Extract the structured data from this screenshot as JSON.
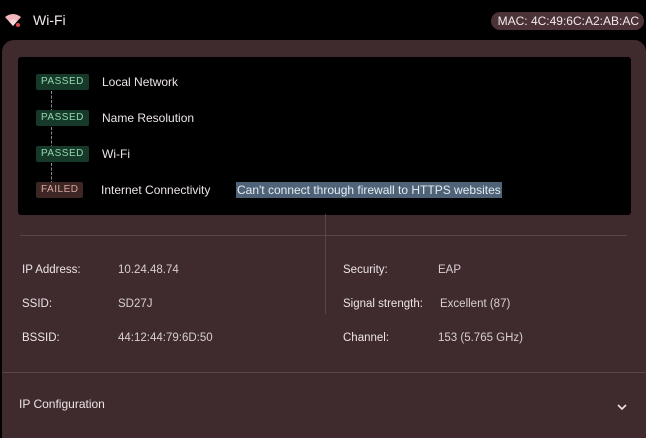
{
  "header": {
    "title": "Wi-Fi",
    "mac": "MAC: 4C:49:6C:A2:AB:AC",
    "icon": "wifi-icon"
  },
  "diagnostics": {
    "steps": [
      {
        "status": "PASSED",
        "label": "Local Network"
      },
      {
        "status": "PASSED",
        "label": "Name Resolution"
      },
      {
        "status": "PASSED",
        "label": "Wi-Fi"
      },
      {
        "status": "FAILED",
        "label": "Internet Connectivity",
        "message": "Can't connect through firewall to HTTPS websites"
      }
    ]
  },
  "details": {
    "left": [
      {
        "label": "IP Address:",
        "value": "10.24.48.74"
      },
      {
        "label": "SSID:",
        "value": "SD27J"
      },
      {
        "label": "BSSID:",
        "value": "44:12:44:79:6D:50"
      }
    ],
    "right": [
      {
        "label": "Security:",
        "value": "EAP"
      },
      {
        "label": "Signal strength:",
        "value": "Excellent (87)"
      },
      {
        "label": "Channel:",
        "value": "153 (5.765 GHz)"
      }
    ]
  },
  "ip_config": {
    "label": "IP Configuration",
    "icon": "chevron-down-icon"
  },
  "colors": {
    "panel_bg": "#3f2b2d",
    "passed_badge": "#17392a",
    "failed_badge": "#3d2624",
    "highlight": "#4e6377"
  }
}
